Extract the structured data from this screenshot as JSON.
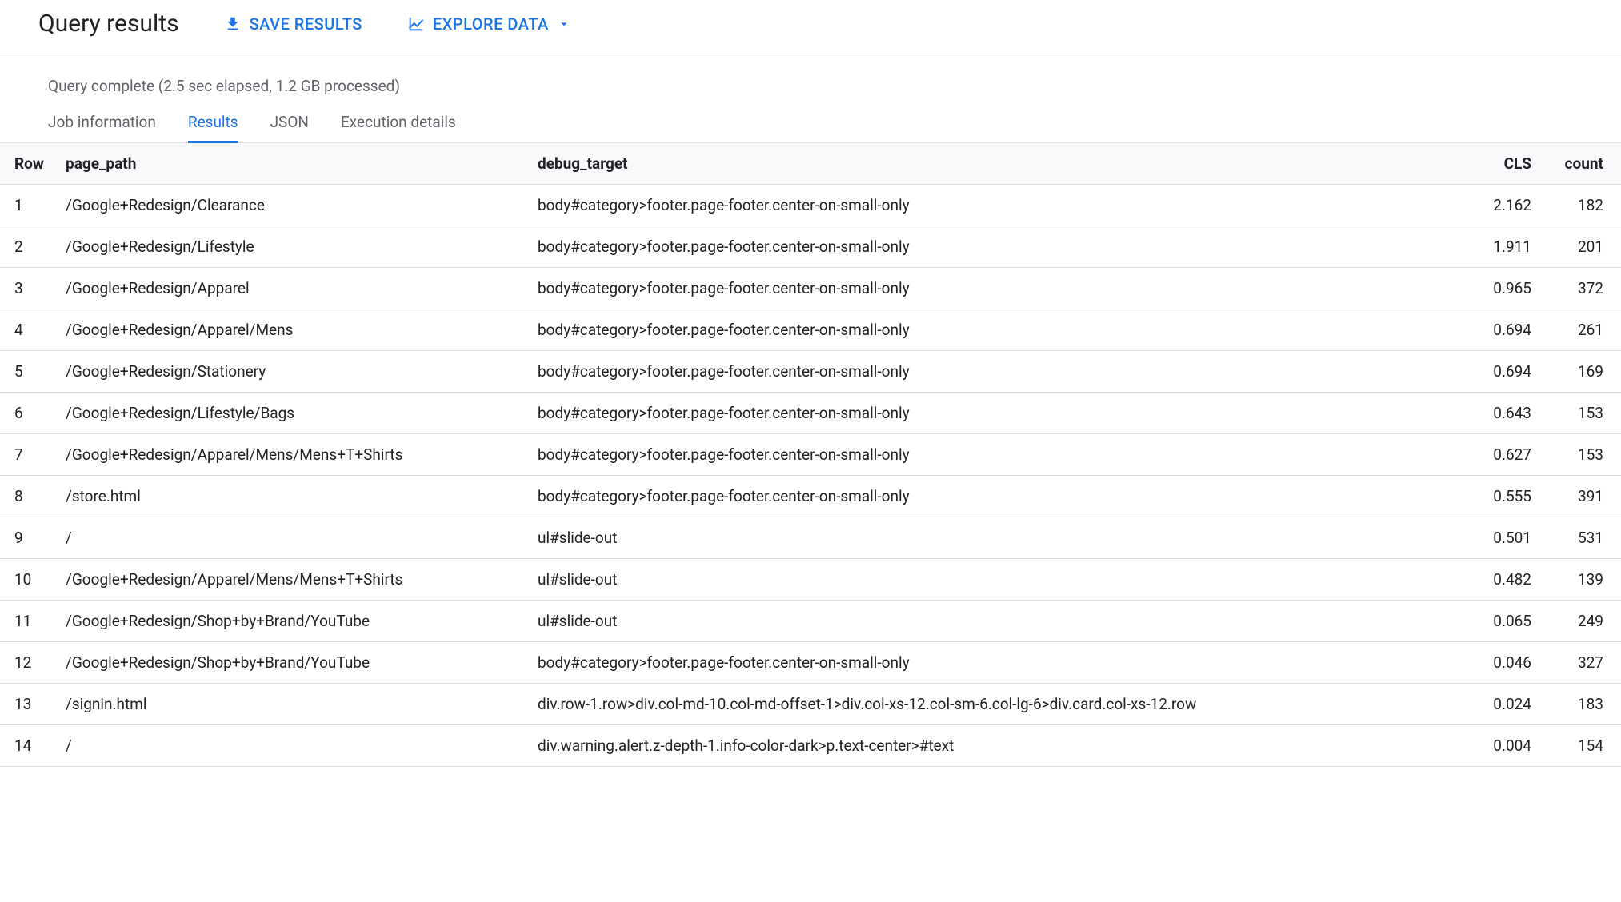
{
  "header": {
    "title": "Query results",
    "save_label": "SAVE RESULTS",
    "explore_label": "EXPLORE DATA"
  },
  "status": "Query complete (2.5 sec elapsed, 1.2 GB processed)",
  "tabs": [
    {
      "label": "Job information",
      "active": false
    },
    {
      "label": "Results",
      "active": true
    },
    {
      "label": "JSON",
      "active": false
    },
    {
      "label": "Execution details",
      "active": false
    }
  ],
  "columns": [
    "Row",
    "page_path",
    "debug_target",
    "CLS",
    "count"
  ],
  "rows": [
    {
      "row": "1",
      "page_path": "/Google+Redesign/Clearance",
      "debug_target": "body#category>footer.page-footer.center-on-small-only",
      "cls": "2.162",
      "count": "182"
    },
    {
      "row": "2",
      "page_path": "/Google+Redesign/Lifestyle",
      "debug_target": "body#category>footer.page-footer.center-on-small-only",
      "cls": "1.911",
      "count": "201"
    },
    {
      "row": "3",
      "page_path": "/Google+Redesign/Apparel",
      "debug_target": "body#category>footer.page-footer.center-on-small-only",
      "cls": "0.965",
      "count": "372"
    },
    {
      "row": "4",
      "page_path": "/Google+Redesign/Apparel/Mens",
      "debug_target": "body#category>footer.page-footer.center-on-small-only",
      "cls": "0.694",
      "count": "261"
    },
    {
      "row": "5",
      "page_path": "/Google+Redesign/Stationery",
      "debug_target": "body#category>footer.page-footer.center-on-small-only",
      "cls": "0.694",
      "count": "169"
    },
    {
      "row": "6",
      "page_path": "/Google+Redesign/Lifestyle/Bags",
      "debug_target": "body#category>footer.page-footer.center-on-small-only",
      "cls": "0.643",
      "count": "153"
    },
    {
      "row": "7",
      "page_path": "/Google+Redesign/Apparel/Mens/Mens+T+Shirts",
      "debug_target": "body#category>footer.page-footer.center-on-small-only",
      "cls": "0.627",
      "count": "153"
    },
    {
      "row": "8",
      "page_path": "/store.html",
      "debug_target": "body#category>footer.page-footer.center-on-small-only",
      "cls": "0.555",
      "count": "391"
    },
    {
      "row": "9",
      "page_path": "/",
      "debug_target": "ul#slide-out",
      "cls": "0.501",
      "count": "531"
    },
    {
      "row": "10",
      "page_path": "/Google+Redesign/Apparel/Mens/Mens+T+Shirts",
      "debug_target": "ul#slide-out",
      "cls": "0.482",
      "count": "139"
    },
    {
      "row": "11",
      "page_path": "/Google+Redesign/Shop+by+Brand/YouTube",
      "debug_target": "ul#slide-out",
      "cls": "0.065",
      "count": "249"
    },
    {
      "row": "12",
      "page_path": "/Google+Redesign/Shop+by+Brand/YouTube",
      "debug_target": "body#category>footer.page-footer.center-on-small-only",
      "cls": "0.046",
      "count": "327"
    },
    {
      "row": "13",
      "page_path": "/signin.html",
      "debug_target": "div.row-1.row>div.col-md-10.col-md-offset-1>div.col-xs-12.col-sm-6.col-lg-6>div.card.col-xs-12.row",
      "cls": "0.024",
      "count": "183"
    },
    {
      "row": "14",
      "page_path": "/",
      "debug_target": "div.warning.alert.z-depth-1.info-color-dark>p.text-center>#text",
      "cls": "0.004",
      "count": "154"
    }
  ]
}
